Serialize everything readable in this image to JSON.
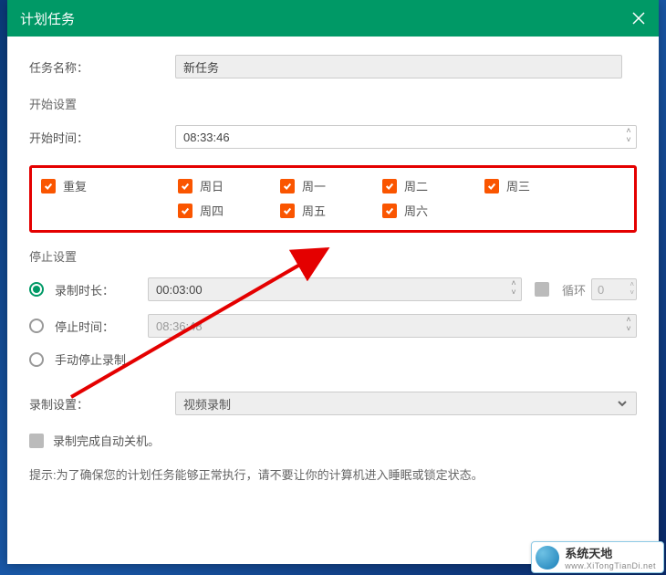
{
  "title": "计划任务",
  "labels": {
    "task_name": "任务名称：",
    "start_section": "开始设置",
    "start_time": "开始时间：",
    "stop_section": "停止设置",
    "rec_duration": "录制时长：",
    "stop_time": "停止时间：",
    "manual_stop": "手动停止录制",
    "loop": "循环",
    "rec_settings": "录制设置：",
    "auto_shutdown": "录制完成自动关机。"
  },
  "values": {
    "task_name": "新任务",
    "start_time": "08:33:46",
    "rec_duration": "00:03:00",
    "stop_time": "08:36:48",
    "loop_count": "0",
    "rec_mode": "视频录制"
  },
  "repeat": {
    "label": "重复",
    "days": [
      "周日",
      "周一",
      "周二",
      "周三",
      "周四",
      "周五",
      "周六"
    ]
  },
  "hint": "提示:为了确保您的计划任务能够正常执行，请不要让你的计算机进入睡眠或锁定状态。",
  "watermark": {
    "name": "系统天地",
    "url": "www.XiTongTianDi.net"
  }
}
